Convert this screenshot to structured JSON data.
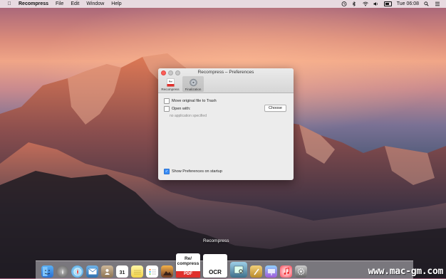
{
  "menubar": {
    "app_name": "Recompress",
    "menus": [
      "File",
      "Edit",
      "Window",
      "Help"
    ],
    "clock": "Tue 06:08"
  },
  "window": {
    "title": "Recompress – Preferences",
    "tabs": [
      {
        "label": "Recompress"
      },
      {
        "label": "Finalization"
      }
    ],
    "options": {
      "move_to_trash": {
        "label": "Move original file to Trash",
        "checked": false
      },
      "open_with": {
        "label": "Open with:",
        "checked": false,
        "hint": "no application specified"
      },
      "choose_button": "Choose",
      "show_prefs": {
        "label": "Show Preferences on startup",
        "checked": true
      }
    }
  },
  "dock": {
    "hover_label": "Recompress",
    "recompress_icon_text": [
      "Re/",
      "compress",
      "PDF"
    ],
    "ocr_icon_text": "OCR",
    "calendar_day": "31"
  },
  "watermark": "www.mac-gm.com",
  "colors": {
    "accent": "#3a8ef6",
    "close": "#fc5f57",
    "pdf_red": "#e0302c"
  }
}
